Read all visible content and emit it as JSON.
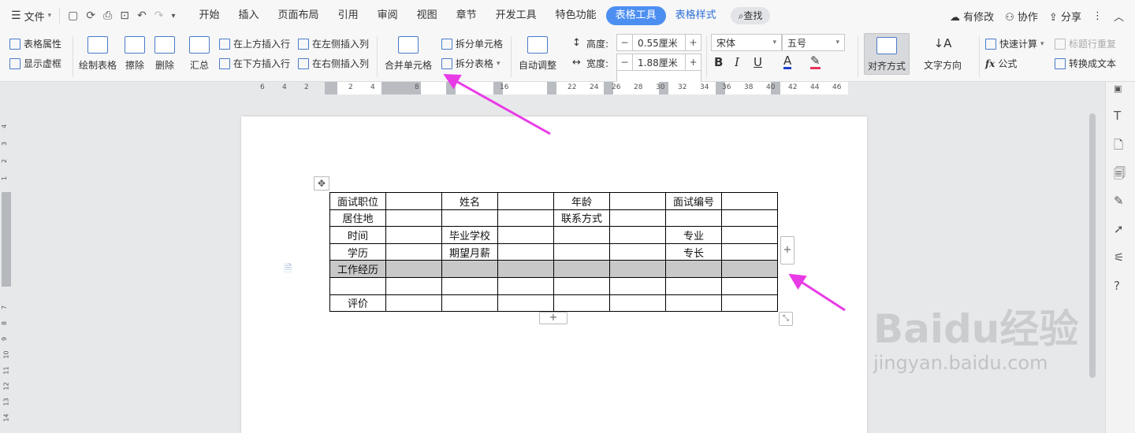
{
  "menubar": {
    "file_label": "文件",
    "tabs": [
      "开始",
      "插入",
      "页面布局",
      "引用",
      "审阅",
      "视图",
      "章节",
      "开发工具",
      "特色功能"
    ],
    "active_tab": "表格工具",
    "style_tab": "表格样式",
    "search_label": "查找",
    "right_items": [
      "有修改",
      "协作",
      "分享"
    ]
  },
  "toolbar": {
    "table_props": "表格属性",
    "show_gridlines": "显示虚框",
    "draw_table": "绘制表格",
    "erase": "擦除",
    "delete": "删除",
    "summary": "汇总",
    "insert_above": "在上方插入行",
    "insert_below": "在下方插入行",
    "insert_left": "在左侧插入列",
    "insert_right": "在右侧插入列",
    "merge_cells": "合并单元格",
    "split_cells": "拆分单元格",
    "split_table": "拆分表格",
    "auto_fit": "自动调整",
    "height_label": "高度:",
    "height_value": "0.55厘米",
    "width_label": "宽度:",
    "width_value": "1.88厘米",
    "font_name": "宋体",
    "font_size": "五号",
    "align": "对齐方式",
    "text_direction": "文字方向",
    "quick_calc": "快速计算",
    "title_repeat": "标题行重复",
    "formula": "公式",
    "to_text": "转换成文本"
  },
  "ruler": {
    "top_numbers": [
      "6",
      "4",
      "2",
      "2",
      "4",
      "8",
      "16",
      "22",
      "24",
      "26",
      "28",
      "30",
      "32",
      "34",
      "36",
      "38",
      "40",
      "42",
      "44",
      "46"
    ],
    "left_numbers": [
      "4",
      "3",
      "2",
      "1",
      "7",
      "8",
      "9",
      "10",
      "11",
      "12",
      "13",
      "14"
    ]
  },
  "table": {
    "rows": [
      [
        "面试职位",
        "",
        "姓名",
        "",
        "年龄",
        "",
        "面试编号",
        ""
      ],
      [
        "居住地",
        "",
        "",
        "",
        "联系方式",
        "",
        "",
        ""
      ],
      [
        "时间",
        "",
        "毕业学校",
        "",
        "",
        "",
        "专业",
        ""
      ],
      [
        "学历",
        "",
        "期望月薪",
        "",
        "",
        "",
        "专长",
        ""
      ],
      [
        "工作经历",
        "",
        "",
        "",
        "",
        "",
        "",
        ""
      ],
      [
        "",
        "",
        "",
        "",
        "",
        "",
        "",
        ""
      ],
      [
        "评价",
        "",
        "",
        "",
        "",
        "",
        "",
        ""
      ]
    ],
    "shaded_row_index": 4
  },
  "colors": {
    "accent": "#4c8ff1",
    "arrow": "#e83be6",
    "shade": "#c8c8c8"
  },
  "watermark": {
    "brand": "Baidu经验",
    "url": "jingyan.baidu.com"
  }
}
